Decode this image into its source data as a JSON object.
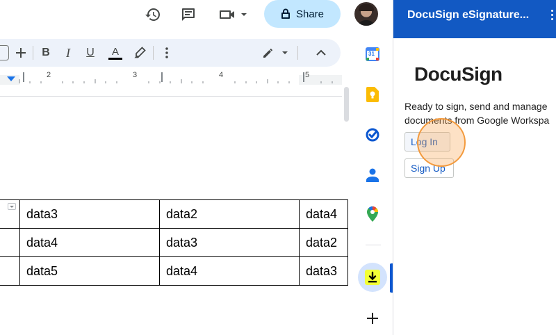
{
  "topbar": {
    "share_label": "Share",
    "icons": [
      "history-icon",
      "comment-icon",
      "meet-icon",
      "lock-icon"
    ]
  },
  "toolbar": {
    "buttons": [
      "plus-icon",
      "bold-icon",
      "italic-icon",
      "underline-icon",
      "text-color-icon",
      "highlight-icon",
      "more-icon",
      "editing-mode-icon",
      "collapse-icon"
    ],
    "bold_label": "B",
    "italic_label": "I",
    "underline_label": "U",
    "text_color_label": "A",
    "text_color": "#000000"
  },
  "ruler": {
    "labels": [
      "2",
      "3",
      "4",
      "5"
    ]
  },
  "table": {
    "rows": [
      [
        "data3",
        "data2",
        "data4"
      ],
      [
        "data4",
        "data3",
        "data2"
      ],
      [
        "data5",
        "data4",
        "data3"
      ]
    ]
  },
  "rail": {
    "icons": [
      "calendar-icon",
      "keep-icon",
      "tasks-icon",
      "contacts-icon",
      "maps-icon",
      "download-addon-icon",
      "add-icon"
    ],
    "calendar_day": "31"
  },
  "panel": {
    "title": "DocuSign eSignature...",
    "brand": "DocuSign",
    "description_line1": "Ready to sign, send and manage",
    "description_line2": "documents from Google Workspa",
    "login_label": "Log In",
    "signup_label": "Sign Up",
    "header_color": "#1259c3"
  }
}
